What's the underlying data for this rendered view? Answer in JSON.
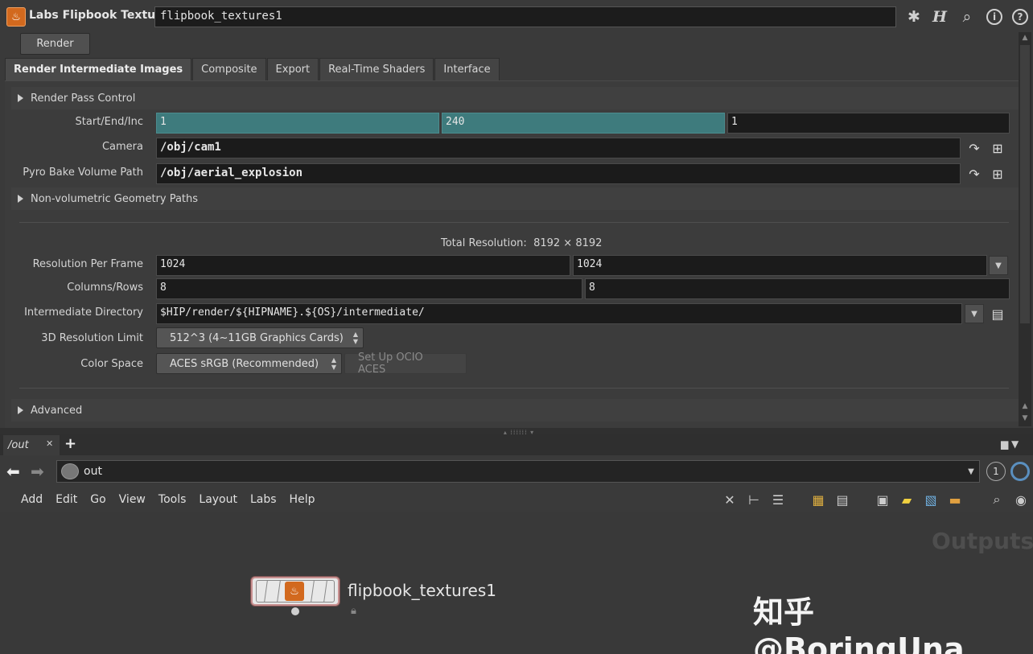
{
  "header": {
    "node_icon": "flame-node-icon",
    "node_type": "Labs Flipbook Textures",
    "node_name": "flipbook_textures1",
    "icons": [
      "gear-icon",
      "houdini-help-icon",
      "search-icon",
      "info-icon",
      "help-icon"
    ]
  },
  "render_button": "Render",
  "tabs": [
    {
      "label": "Render Intermediate Images",
      "active": true
    },
    {
      "label": "Composite",
      "active": false
    },
    {
      "label": "Export",
      "active": false
    },
    {
      "label": "Real-Time Shaders",
      "active": false
    },
    {
      "label": "Interface",
      "active": false
    }
  ],
  "folders": {
    "render_pass": "Render Pass Control",
    "non_volumetric": "Non-volumetric Geometry Paths",
    "advanced": "Advanced"
  },
  "params": {
    "start_end_inc": {
      "label": "Start/End/Inc",
      "values": [
        "1",
        "240",
        "1"
      ]
    },
    "camera": {
      "label": "Camera",
      "value": "/obj/cam1"
    },
    "pyro_path": {
      "label": "Pyro Bake Volume Path",
      "value": "/obj/aerial_explosion"
    },
    "total_resolution": {
      "label": "Total Resolution:",
      "value": "8192 × 8192"
    },
    "res_per_frame": {
      "label": "Resolution Per Frame",
      "values": [
        "1024",
        "1024"
      ]
    },
    "columns_rows": {
      "label": "Columns/Rows",
      "values": [
        "8",
        "8"
      ]
    },
    "intermediate_dir": {
      "label": "Intermediate Directory",
      "value": "$HIP/render/${HIPNAME}.${OS}/intermediate/"
    },
    "res_limit": {
      "label": "3D Resolution Limit",
      "value": "512^3 (4~11GB Graphics Cards)"
    },
    "color_space": {
      "label": "Color Space",
      "value": "ACES sRGB (Recommended)",
      "button": "Set Up OCIO ACES"
    }
  },
  "network": {
    "tab_label": "/out",
    "path_text": "out",
    "badge": "1",
    "menus": [
      "Add",
      "Edit",
      "Go",
      "View",
      "Tools",
      "Layout",
      "Labs",
      "Help"
    ],
    "context_label": "Outputs",
    "node_label": "flipbook_textures1"
  },
  "watermark": "知乎 @BoringUna",
  "colors": {
    "accent_teal": "#3e7b7d",
    "node_orange": "#d2691e",
    "background": "#3a3a3a"
  }
}
